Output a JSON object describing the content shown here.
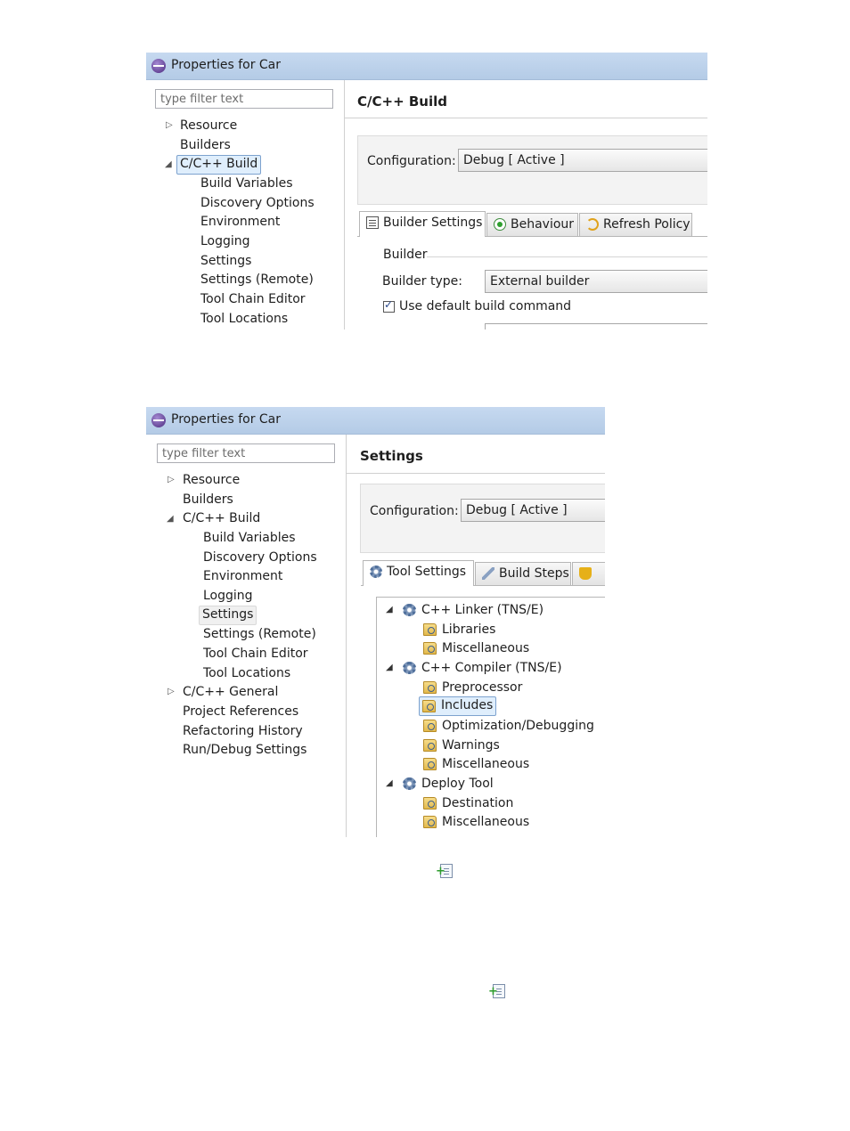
{
  "window1": {
    "title": "Properties for Car",
    "filter_placeholder": "type filter text",
    "tree": [
      "Resource",
      "Builders",
      "C/C++ Build",
      "Build Variables",
      "Discovery Options",
      "Environment",
      "Logging",
      "Settings",
      "Settings (Remote)",
      "Tool Chain Editor",
      "Tool Locations"
    ],
    "heading": "C/C++ Build",
    "config_label": "Configuration:",
    "config_value": "Debug  [ Active ]",
    "tabs": [
      "Builder Settings",
      "Behaviour",
      "Refresh Policy"
    ],
    "builder_group": "Builder",
    "builder_type_label": "Builder type:",
    "builder_type_value": "External builder",
    "use_default_label": "Use default build command"
  },
  "window2": {
    "title": "Properties for Car",
    "filter_placeholder": "type filter text",
    "tree": [
      "Resource",
      "Builders",
      "C/C++ Build",
      "Build Variables",
      "Discovery Options",
      "Environment",
      "Logging",
      "Settings",
      "Settings (Remote)",
      "Tool Chain Editor",
      "Tool Locations",
      "C/C++ General",
      "Project References",
      "Refactoring History",
      "Run/Debug Settings"
    ],
    "heading": "Settings",
    "config_label": "Configuration:",
    "config_value": "Debug  [ Active ]",
    "tabs": [
      "Tool Settings",
      "Build Steps"
    ],
    "tool_tree": [
      {
        "label": "C++ Linker (TNS/E)",
        "children": [
          "Libraries",
          "Miscellaneous"
        ]
      },
      {
        "label": "C++ Compiler (TNS/E)",
        "children": [
          "Preprocessor",
          "Includes",
          "Optimization/Debugging",
          "Warnings",
          "Miscellaneous"
        ]
      },
      {
        "label": "Deploy Tool",
        "children": [
          "Destination",
          "Miscellaneous"
        ]
      }
    ]
  },
  "icons": {
    "add_include_icon_1": "add-file-icon",
    "add_include_icon_2": "add-file-icon"
  }
}
